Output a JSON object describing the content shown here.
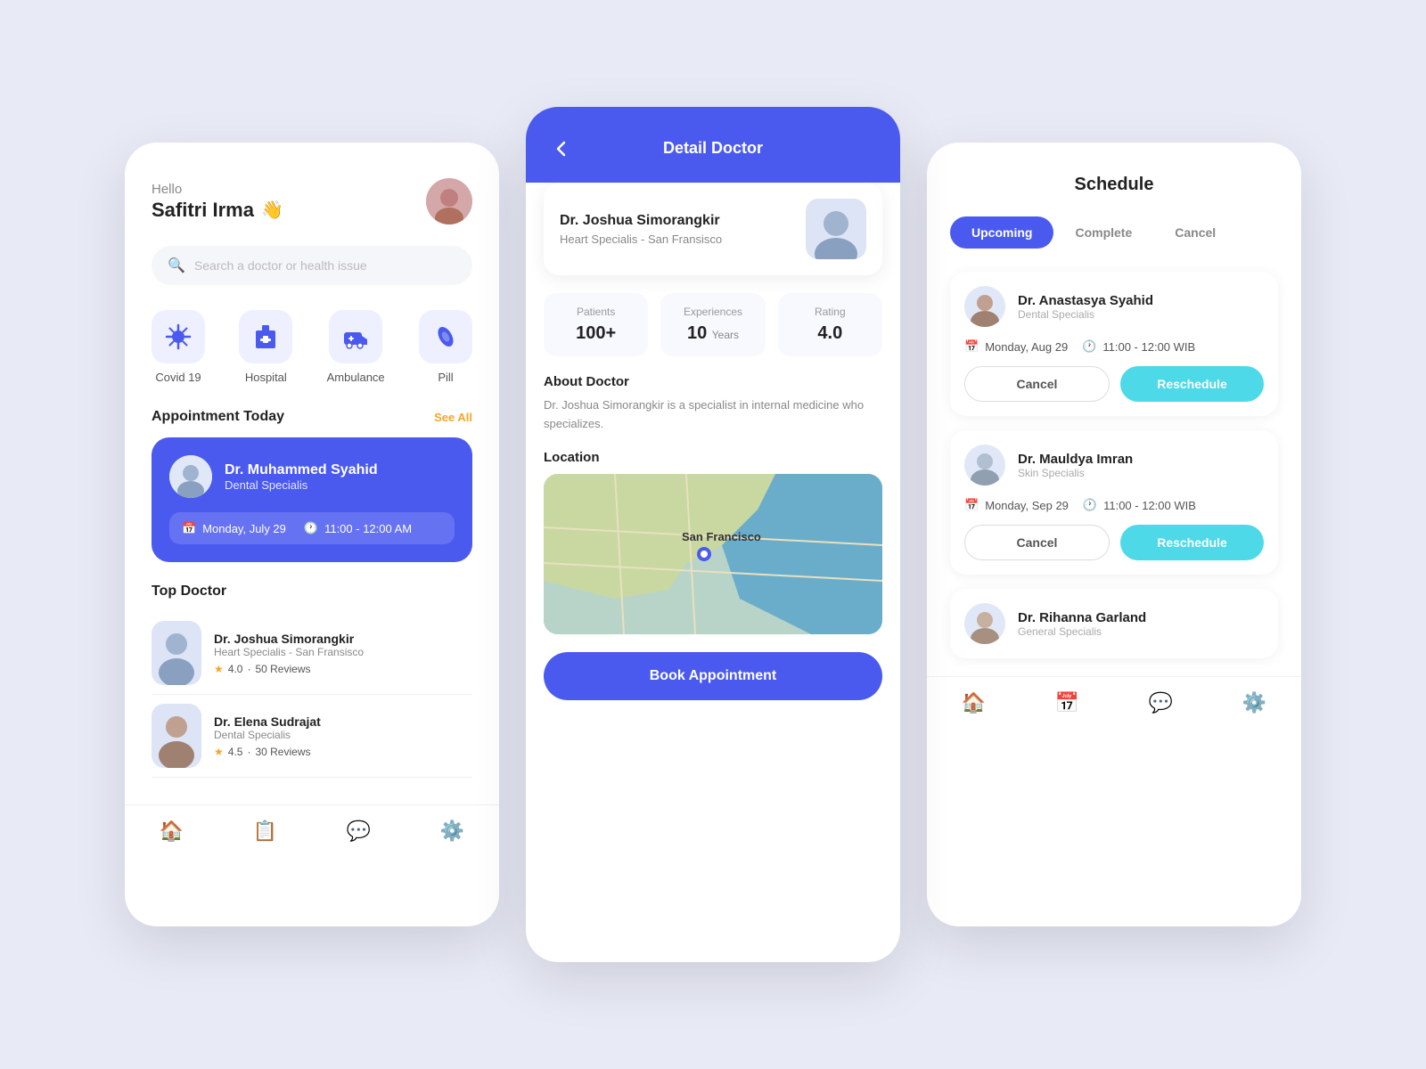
{
  "app": {
    "bg_color": "#e8eaf6"
  },
  "phone1": {
    "greeting": "Hello",
    "username": "Safitri Irma",
    "wave": "👋",
    "search_placeholder": "Search a doctor or health issue",
    "categories": [
      {
        "id": "covid19",
        "label": "Covid 19",
        "emoji": "🦠"
      },
      {
        "id": "hospital",
        "label": "Hospital",
        "emoji": "🏥"
      },
      {
        "id": "ambulance",
        "label": "Ambulance",
        "emoji": "🚑"
      },
      {
        "id": "pill",
        "label": "Pill",
        "emoji": "💊"
      }
    ],
    "section_appointment": "Appointment Today",
    "see_all": "See All",
    "appt_doctor_name": "Dr. Muhammed Syahid",
    "appt_specialty": "Dental Specialis",
    "appt_date": "Monday, July 29",
    "appt_time": "11:00 - 12:00 AM",
    "top_doctor_title": "Top Doctor",
    "doctors": [
      {
        "name": "Dr. Joshua Simorangkir",
        "specialty": "Heart Specialis - San Fransisco",
        "rating": "4.0",
        "reviews": "50 Reviews"
      },
      {
        "name": "Dr. Elena Sudrajat",
        "specialty": "Dental Specialis",
        "rating": "4.5",
        "reviews": "30 Reviews"
      }
    ],
    "nav_icons": [
      "🏠",
      "📋",
      "💬",
      "⚙️"
    ]
  },
  "phone2": {
    "title": "Detail Doctor",
    "back_icon": "←",
    "doctor_name": "Dr. Joshua Simorangkir",
    "doctor_specialty": "Heart Specialis - San Fransisco",
    "stat_patients_label": "Patients",
    "stat_patients_value": "100+",
    "stat_exp_label": "Experiences",
    "stat_exp_value": "10",
    "stat_exp_sub": "Years",
    "stat_rating_label": "Rating",
    "stat_rating_value": "4.0",
    "about_title": "About Doctor",
    "about_text": "Dr. Joshua Simorangkir is a specialist in internal medicine who specializes.",
    "location_title": "Location",
    "location_city": "San Francisco",
    "book_button": "Book Appointment"
  },
  "phone3": {
    "title": "Schedule",
    "tabs": [
      "Upcoming",
      "Complete",
      "Cancel"
    ],
    "active_tab": "Upcoming",
    "schedules": [
      {
        "doctor_name": "Dr. Anastasya Syahid",
        "specialty": "Dental Specialis",
        "date": "Monday, Aug 29",
        "time": "11:00 - 12:00 WIB",
        "cancel_label": "Cancel",
        "reschedule_label": "Reschedule"
      },
      {
        "doctor_name": "Dr. Mauldya Imran",
        "specialty": "Skin Specialis",
        "date": "Monday, Sep 29",
        "time": "11:00 - 12:00 WIB",
        "cancel_label": "Cancel",
        "reschedule_label": "Reschedule"
      }
    ],
    "third_doctor": {
      "name": "Dr. Rihanna Garland",
      "specialty": "General Specialis"
    },
    "nav_icons": [
      "🏠",
      "📅",
      "💬",
      "⚙️"
    ]
  }
}
